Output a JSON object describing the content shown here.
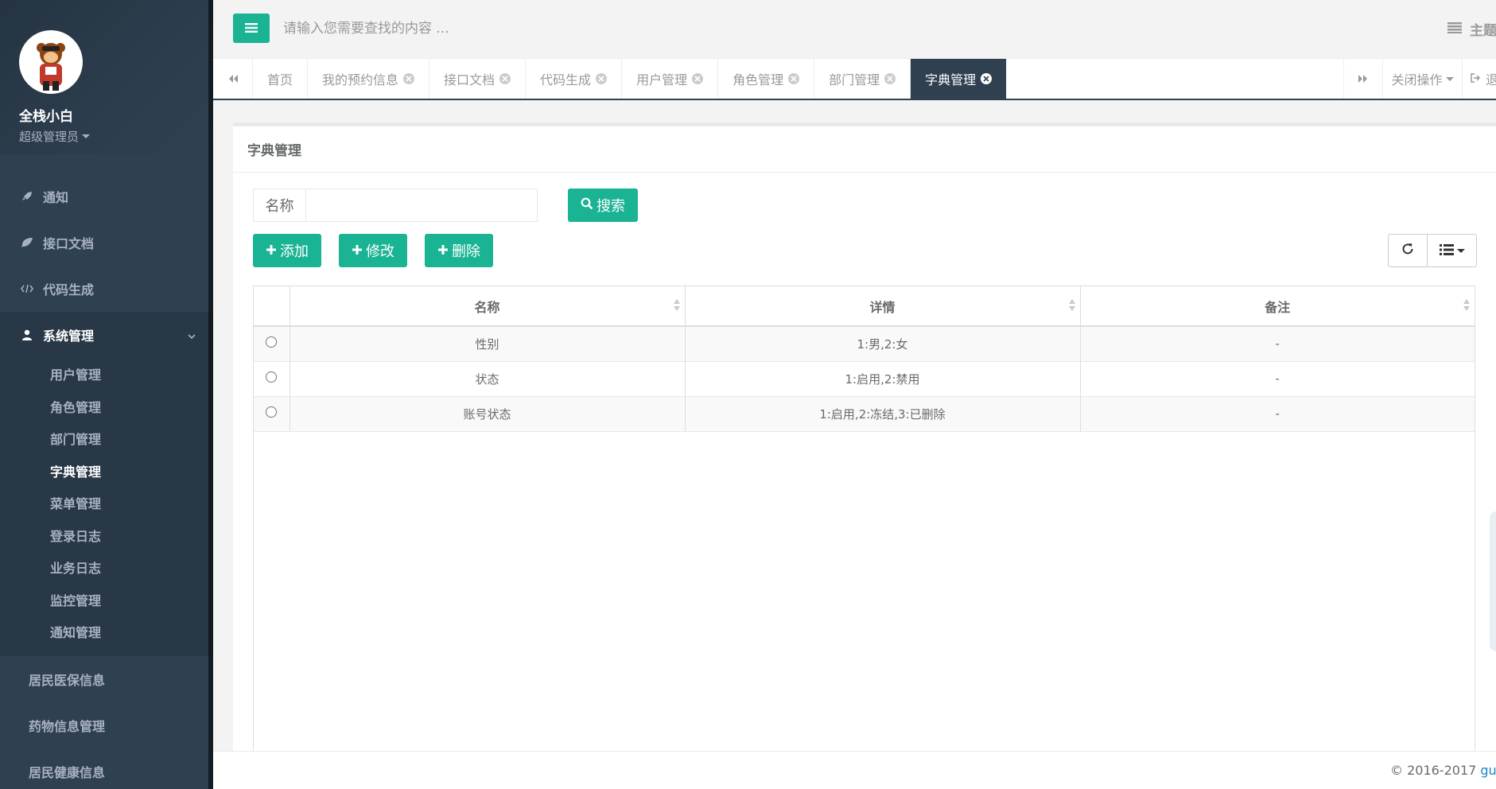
{
  "user": {
    "name": "全栈小白",
    "role": "超级管理员"
  },
  "sidebar": {
    "items": [
      {
        "label": "通知",
        "icon": "rocket-icon"
      },
      {
        "label": "接口文档",
        "icon": "leaf-icon"
      },
      {
        "label": "代码生成",
        "icon": "code-icon"
      },
      {
        "label": "系统管理",
        "icon": "user-icon"
      }
    ],
    "submenu": [
      "用户管理",
      "角色管理",
      "部门管理",
      "字典管理",
      "菜单管理",
      "登录日志",
      "业务日志",
      "监控管理",
      "通知管理"
    ],
    "extra": [
      "居民医保信息",
      "药物信息管理",
      "居民健康信息"
    ]
  },
  "topbar": {
    "search_placeholder": "请输入您需要查找的内容 ...",
    "theme": "主题"
  },
  "tabs": [
    "首页",
    "我的预约信息",
    "接口文档",
    "代码生成",
    "用户管理",
    "角色管理",
    "部门管理",
    "字典管理"
  ],
  "tabbar": {
    "close_ops": "关闭操作",
    "logout": "退"
  },
  "panel": {
    "title": "字典管理",
    "search_label": "名称",
    "search_button": "搜索",
    "add_button": "添加",
    "edit_button": "修改",
    "delete_button": "删除"
  },
  "table": {
    "headers": [
      "名称",
      "详情",
      "备注"
    ],
    "rows": [
      {
        "name": "性别",
        "detail": "1:男,2:女",
        "remark": "-"
      },
      {
        "name": "状态",
        "detail": "1:启用,2:禁用",
        "remark": "-"
      },
      {
        "name": "账号状态",
        "detail": "1:启用,2:冻结,3:已删除",
        "remark": "-"
      }
    ]
  },
  "footer": {
    "copyright": "© 2016-2017 ",
    "link": "gun"
  },
  "colors": {
    "primary": "#1ab394",
    "sidebar": "#2f4050",
    "active_tab": "#2f4050"
  }
}
